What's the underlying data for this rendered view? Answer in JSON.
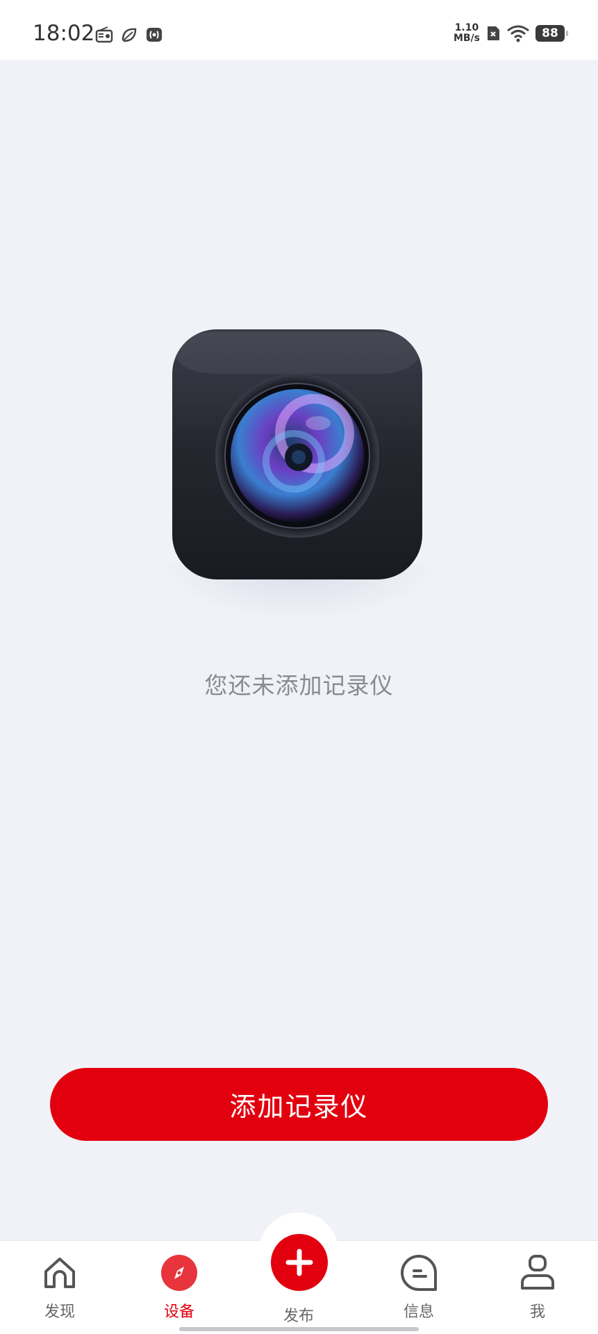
{
  "status_bar": {
    "time": "18:02",
    "net_speed_value": "1.10",
    "net_speed_unit": "MB/s",
    "battery": "88"
  },
  "main": {
    "empty_message": "您还未添加记录仪",
    "add_button_label": "添加记录仪"
  },
  "tabbar": {
    "items": [
      {
        "label": "发现",
        "icon": "home-icon"
      },
      {
        "label": "设备",
        "icon": "compass-icon"
      },
      {
        "label": "发布",
        "icon": "plus-icon"
      },
      {
        "label": "信息",
        "icon": "message-icon"
      },
      {
        "label": "我",
        "icon": "user-icon"
      }
    ],
    "active_index": 1
  },
  "colors": {
    "accent": "#e2000f",
    "background": "#f1f2f7"
  }
}
